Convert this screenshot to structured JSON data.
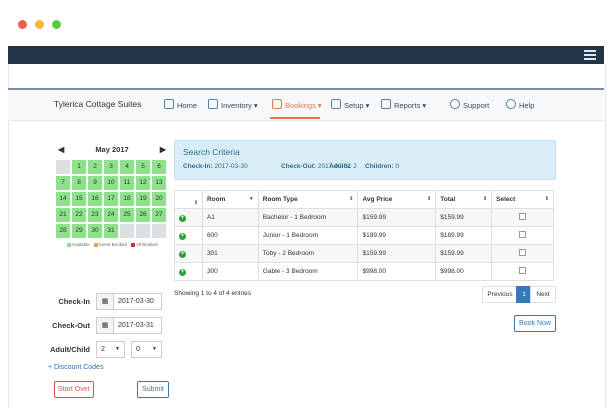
{
  "window": {
    "dot_colors": [
      "#ed5e55",
      "#f5b43a",
      "#5dc84a"
    ]
  },
  "nav": {
    "brand": "Tylerica Cottage Suites",
    "items": [
      {
        "label": "Home",
        "icon": "home-icon"
      },
      {
        "label": "Inventory ▾",
        "icon": "cube-icon"
      },
      {
        "label": "Bookings ▾",
        "icon": "bookings-icon",
        "active": true
      },
      {
        "label": "Setup ▾",
        "icon": "gear-icon"
      },
      {
        "label": "Reports ▾",
        "icon": "chart-icon"
      },
      {
        "label": "Support",
        "icon": "globe-icon"
      },
      {
        "label": "Help",
        "icon": "question-icon"
      }
    ]
  },
  "calendar": {
    "month": "May 2017",
    "prev": "◀",
    "next": "▶",
    "legend": [
      "Available",
      "Some Booked",
      "All Booked"
    ],
    "legend_colors": [
      "#8fe08a",
      "#f0a040",
      "#c0392b"
    ]
  },
  "form": {
    "checkin_label": "Check-In",
    "checkin_value": "2017-03-30",
    "checkout_label": "Check-Out",
    "checkout_value": "2017-03-31",
    "adult_child_label": "Adult/Child",
    "adults": "2",
    "children": "0",
    "discount_label": "+ Discount Codes",
    "start_over": "Start Over",
    "submit": "Submit"
  },
  "criteria": {
    "title": "Search Criteria",
    "checkin_label": "Check-In:",
    "checkin": "2017-03-30",
    "checkout_label": "Check-Out:",
    "checkout": "2017-03-31",
    "adults_label": "Adults:",
    "adults": "2",
    "children_label": "Children:",
    "children": "0"
  },
  "table": {
    "headers": [
      "Room",
      "Room Type",
      "Avg Price",
      "Total",
      "Select"
    ],
    "rows": [
      {
        "room": "A1",
        "type": "Bachelor - 1 Bedroom",
        "avg": "$159.99",
        "total": "$159.99"
      },
      {
        "room": "600",
        "type": "Junior - 1 Bedroom",
        "avg": "$189.99",
        "total": "$189.99"
      },
      {
        "room": "301",
        "type": "Toby - 2 Bedroom",
        "avg": "$159.99",
        "total": "$159.99"
      },
      {
        "room": "300",
        "type": "Gable - 3 Bedroom",
        "avg": "$998.00",
        "total": "$998.00"
      }
    ],
    "info": "Showing 1 to 4 of 4 entries",
    "prev": "Previous",
    "page": "1",
    "next": "Next",
    "book_now": "Book Now"
  }
}
